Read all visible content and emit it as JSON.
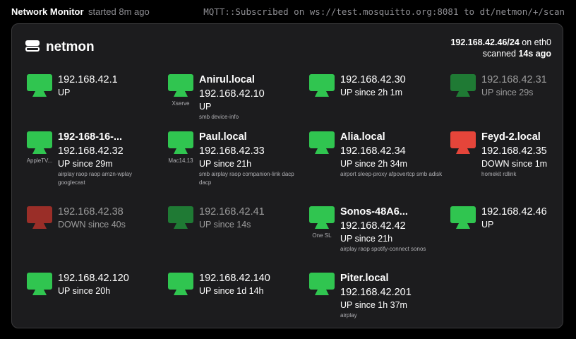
{
  "header": {
    "title": "Network Monitor",
    "started": "started 8m ago",
    "mqtt": "MQTT::Subscribed on ws://test.mosquitto.org:8081 to dt/netmon/+/scan"
  },
  "panel": {
    "brand": "netmon",
    "subnet": "192.168.42.46/24",
    "on_label": "on",
    "iface": "eth0",
    "scanned_label": "scanned",
    "scanned_ago": "14s ago"
  },
  "colors": {
    "up": "#30c550",
    "up_dim": "#1f7a34",
    "down": "#e5453a",
    "down_dim": "#9a2e28"
  },
  "hosts": [
    {
      "icon": "desktop-icon",
      "name": "",
      "ip": "192.168.42.1",
      "status": "UP",
      "services": "",
      "model": "",
      "state": "up"
    },
    {
      "icon": "desktop-icon",
      "name": "Anirul.local",
      "ip": "192.168.42.10",
      "status": "UP",
      "services": "smb  device-info",
      "model": "Xserve",
      "state": "up"
    },
    {
      "icon": "desktop-icon",
      "name": "",
      "ip": "192.168.42.30",
      "status": "UP since 2h 1m",
      "services": "",
      "model": "",
      "state": "up"
    },
    {
      "icon": "desktop-icon",
      "name": "",
      "ip": "192.168.42.31",
      "status": "UP since 29s",
      "services": "",
      "model": "",
      "state": "up-dim"
    },
    {
      "icon": "desktop-icon",
      "name": "192-168-16-...",
      "ip": "192.168.42.32",
      "status": "UP since 29m",
      "services": "airplay  raop  raop  amzn-wplay  googlecast",
      "model": "AppleTV...",
      "state": "up"
    },
    {
      "icon": "desktop-icon",
      "name": "Paul.local",
      "ip": "192.168.42.33",
      "status": "UP since 21h",
      "services": "smb  airplay  raop  companion-link  dacp  dacp",
      "model": "Mac14,13",
      "state": "up"
    },
    {
      "icon": "desktop-icon",
      "name": "Alia.local",
      "ip": "192.168.42.34",
      "status": "UP since 2h 34m",
      "services": "airport  sleep-proxy  afpovertcp  smb  adisk",
      "model": "",
      "state": "up"
    },
    {
      "icon": "desktop-icon",
      "name": "Feyd-2.local",
      "ip": "192.168.42.35",
      "status": "DOWN since 1m",
      "services": "homekit  rdlink",
      "model": "",
      "state": "down"
    },
    {
      "icon": "desktop-icon",
      "name": "",
      "ip": "192.168.42.38",
      "status": "DOWN since 40s",
      "services": "",
      "model": "",
      "state": "down-dim"
    },
    {
      "icon": "desktop-icon",
      "name": "",
      "ip": "192.168.42.41",
      "status": "UP since 14s",
      "services": "",
      "model": "",
      "state": "up-dim"
    },
    {
      "icon": "desktop-icon",
      "name": "Sonos-48A6...",
      "ip": "192.168.42.42",
      "status": "UP since 21h",
      "services": "airplay  raop  spotify-connect  sonos",
      "model": "One SL",
      "state": "up"
    },
    {
      "icon": "desktop-icon",
      "name": "",
      "ip": "192.168.42.46",
      "status": "UP",
      "services": "",
      "model": "",
      "state": "up"
    },
    {
      "icon": "desktop-icon",
      "name": "",
      "ip": "192.168.42.120",
      "status": "UP since 20h",
      "services": "",
      "model": "",
      "state": "up"
    },
    {
      "icon": "desktop-icon",
      "name": "",
      "ip": "192.168.42.140",
      "status": "UP since 1d 14h",
      "services": "",
      "model": "",
      "state": "up"
    },
    {
      "icon": "desktop-icon",
      "name": "Piter.local",
      "ip": "192.168.42.201",
      "status": "UP since 1h 37m",
      "services": "airplay",
      "model": "",
      "state": "up"
    }
  ]
}
